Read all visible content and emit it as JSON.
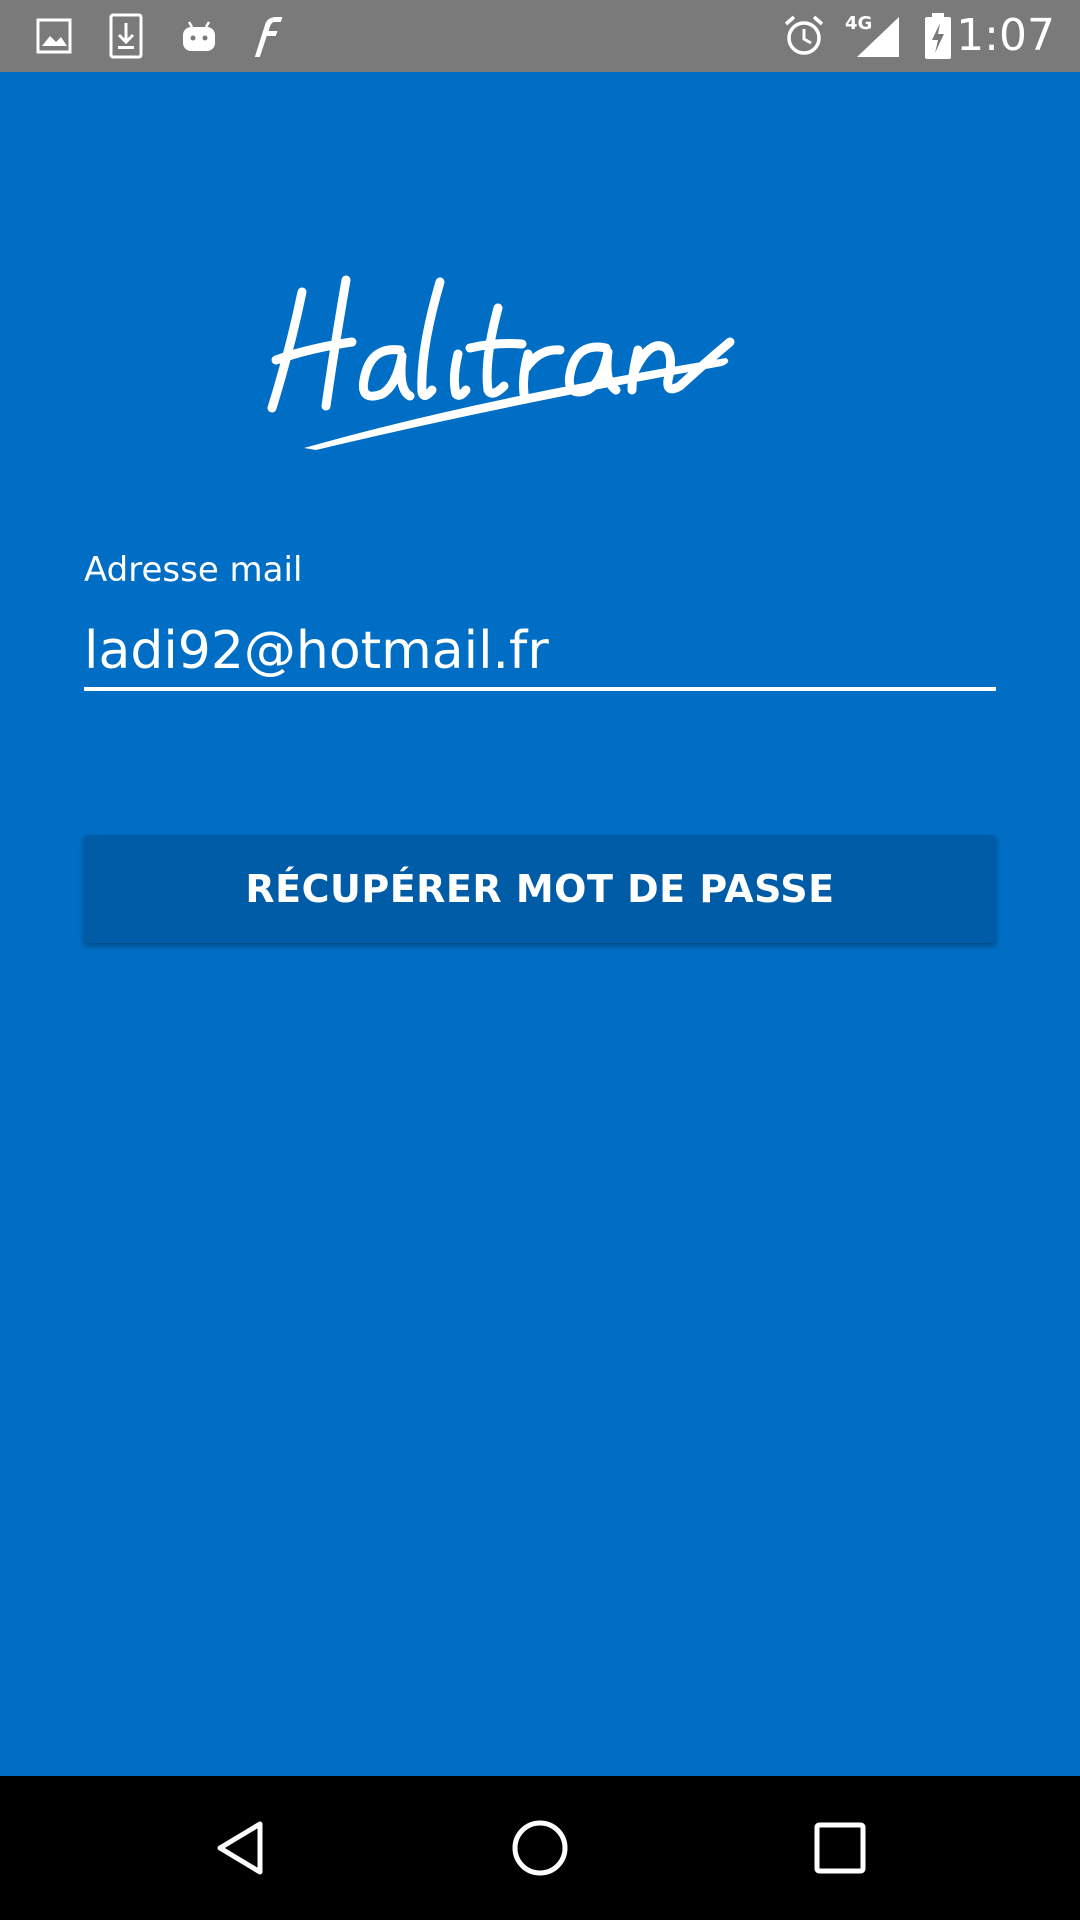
{
  "status_bar": {
    "time": "1:07",
    "network": "4G",
    "icons": [
      "image-icon",
      "download-icon",
      "android-icon",
      "flipboard-icon",
      "alarm-icon",
      "signal-icon",
      "battery-charging-icon"
    ]
  },
  "brand": {
    "logo_text": "Halitran"
  },
  "form": {
    "email_label": "Adresse mail",
    "email_value": "ladi92@hotmail.fr",
    "recover_button_label": "RÉCUPÉRER MOT DE PASSE"
  },
  "nav_bar": {
    "buttons": [
      "back-icon",
      "home-icon",
      "recents-icon"
    ]
  },
  "colors": {
    "background": "#006EC4",
    "button": "#005CA6",
    "status_bar": "#7A7A7A",
    "nav_bar": "#000000",
    "text": "#FFFFFF"
  }
}
